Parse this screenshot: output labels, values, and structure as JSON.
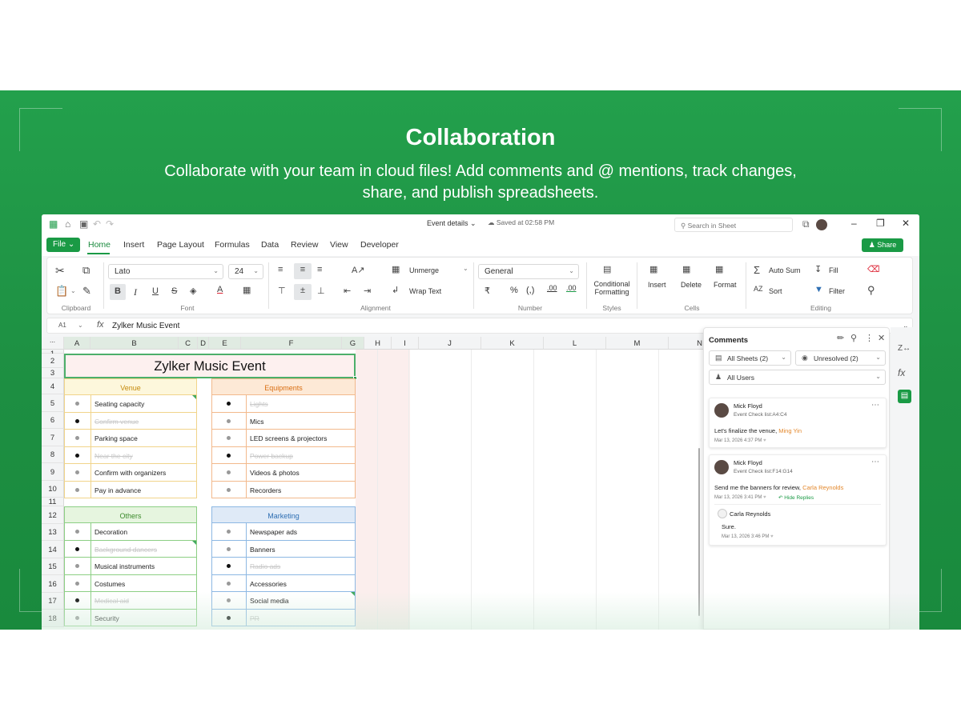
{
  "hero": {
    "title": "Collaboration",
    "subtitle_line1": "Collaborate with your team in cloud files! Add comments and @ mentions, track changes,",
    "subtitle_line2": "share, and publish spreadsheets."
  },
  "titlebar": {
    "doc_title": "Event details",
    "saved": "Saved at 02:58 PM",
    "search_placeholder": "Search in Sheet"
  },
  "menu": {
    "file": "File",
    "items": [
      "Home",
      "Insert",
      "Page Layout",
      "Formulas",
      "Data",
      "Review",
      "View",
      "Developer"
    ],
    "share": "Share"
  },
  "ribbon": {
    "font": "Lato",
    "size": "24",
    "unmerge": "Unmerge",
    "wrap_text": "Wrap Text",
    "number_format": "General",
    "currency": "₹",
    "percent": "%",
    "comma": "(,)",
    "dec_inc": ".00",
    "dec_dec": ".00",
    "conditional_line1": "Conditional",
    "conditional_line2": "Formatting",
    "insert": "Insert",
    "delete": "Delete",
    "format": "Format",
    "auto_sum": "Auto Sum",
    "fill": "Fill",
    "sort": "Sort",
    "filter": "Filter",
    "groups": [
      "Clipboard",
      "Font",
      "Alignment",
      "Number",
      "Styles",
      "Cells",
      "Editing"
    ]
  },
  "formula_bar": {
    "cell_ref": "A1",
    "fx": "fx",
    "value": "Zylker Music Event"
  },
  "grid": {
    "columns": [
      "A",
      "B",
      "C",
      "D",
      "E",
      "F",
      "G",
      "H",
      "I",
      "J",
      "K",
      "L",
      "M",
      "N"
    ],
    "rows": [
      "1",
      "2",
      "3",
      "4",
      "5",
      "6",
      "7",
      "8",
      "9",
      "10",
      "11",
      "12",
      "13",
      "14",
      "15",
      "16",
      "17",
      "18"
    ],
    "title": "Zylker Music Event",
    "venue": {
      "header": "Venue",
      "items": [
        {
          "text": "Seating capacity",
          "done": false
        },
        {
          "text": "Confirm venue",
          "done": true
        },
        {
          "text": "Parking space",
          "done": false
        },
        {
          "text": "Near the city",
          "done": true
        },
        {
          "text": "Confirm with organizers",
          "done": false
        },
        {
          "text": "Pay in advance",
          "done": false
        }
      ]
    },
    "equipments": {
      "header": "Equipments",
      "items": [
        {
          "text": "Lights",
          "done": true
        },
        {
          "text": "Mics",
          "done": false
        },
        {
          "text": "LED screens & projectors",
          "done": false
        },
        {
          "text": "Power backup",
          "done": true
        },
        {
          "text": "Videos & photos",
          "done": false
        },
        {
          "text": "Recorders",
          "done": false
        }
      ]
    },
    "others": {
      "header": "Others",
      "items": [
        {
          "text": "Decoration",
          "done": false
        },
        {
          "text": "Background dancers",
          "done": true
        },
        {
          "text": "Musical instruments",
          "done": false
        },
        {
          "text": "Costumes",
          "done": false
        },
        {
          "text": "Medical aid",
          "done": true
        },
        {
          "text": "Security",
          "done": false
        }
      ]
    },
    "marketing": {
      "header": "Marketing",
      "items": [
        {
          "text": "Newspaper ads",
          "done": false
        },
        {
          "text": "Banners",
          "done": false
        },
        {
          "text": "Radio ads",
          "done": true
        },
        {
          "text": "Accessories",
          "done": false
        },
        {
          "text": "Social media",
          "done": false
        },
        {
          "text": "PR",
          "done": true
        }
      ]
    }
  },
  "comments": {
    "title": "Comments",
    "filter_sheets": "All Sheets (2)",
    "filter_status": "Unresolved (2)",
    "filter_users": "All Users",
    "threads": [
      {
        "author": "Mick Floyd",
        "range": "Event Check list:A4:C4",
        "body": "Let's finalize the venue,",
        "mention": "Ming Yin",
        "time": "Mar 13, 2026 4:37 PM"
      },
      {
        "author": "Mick Floyd",
        "range": "Event Check list:F14:G14",
        "body": "Send me the banners for review,",
        "mention": "Carla Reynolds",
        "time": "Mar 13, 2026 3:41 PM",
        "hide_replies": "Hide Replies",
        "reply": {
          "author": "Carla Reynolds",
          "body": "Sure.",
          "time": "Mar 13, 2026 3:46 PM"
        }
      }
    ]
  },
  "colors": {
    "brand": "#1a9a45",
    "venue_header_bg": "#fdf7dc",
    "venue_header_text": "#c58a0c",
    "equip_header_bg": "#fde9d6",
    "equip_header_text": "#d96e12",
    "others_header_bg": "#e6f5df",
    "others_header_text": "#3c8a2c",
    "marketing_header_bg": "#dfeaf7",
    "marketing_header_text": "#2f6fb3",
    "mention": "#e3872b"
  }
}
